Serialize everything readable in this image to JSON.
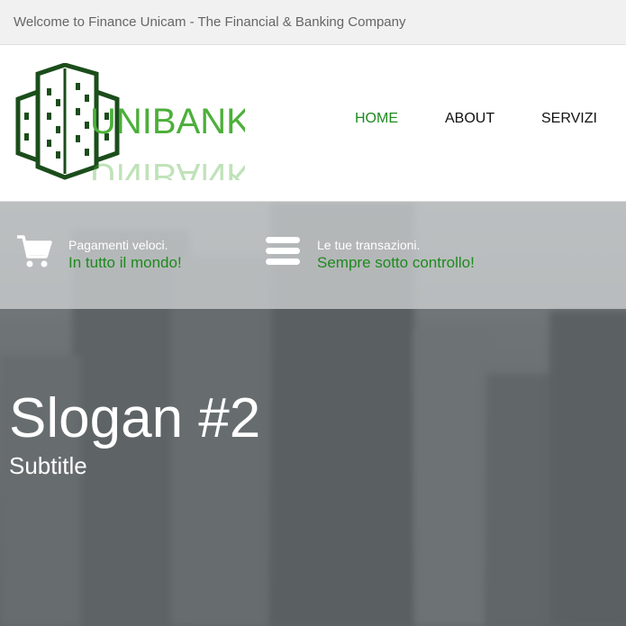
{
  "topbar": {
    "welcome": "Welcome to Finance Unicam - The Financial & Banking Company"
  },
  "brand": {
    "name": "UNIBANK"
  },
  "nav": {
    "items": [
      {
        "label": "HOME",
        "active": true
      },
      {
        "label": "ABOUT",
        "active": false
      },
      {
        "label": "SERVIZI",
        "active": false
      }
    ]
  },
  "features": [
    {
      "icon": "cart-icon",
      "small": "Pagamenti veloci.",
      "big": "In tutto il mondo!"
    },
    {
      "icon": "menu-lines-icon",
      "small": "Le tue transazioni.",
      "big": "Sempre sotto controllo!"
    }
  ],
  "hero": {
    "slogan": "Slogan #2",
    "subtitle": "Subtitle"
  },
  "colors": {
    "accent": "#1d8a1d",
    "logo_dark": "#1b4d1b",
    "logo_green": "#4caf3a"
  }
}
